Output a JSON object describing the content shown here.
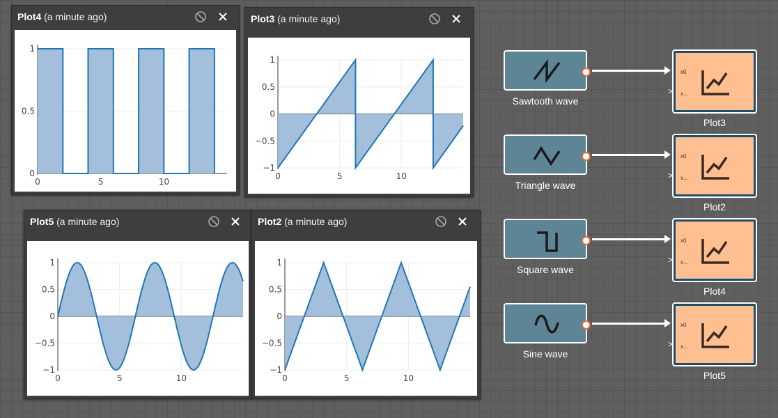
{
  "windows": [
    {
      "id": "plot4",
      "name": "Plot4",
      "ago": "(a minute ago)",
      "xticks": [
        0,
        5,
        10
      ],
      "yticks": [
        "1",
        "0.5",
        "0"
      ],
      "wave": "square",
      "ylim": [
        0,
        1
      ]
    },
    {
      "id": "plot3",
      "name": "Plot3",
      "ago": "(a minute ago)",
      "xticks": [
        0,
        5,
        10
      ],
      "yticks": [
        "1",
        "0.5",
        "0",
        "−0.5",
        "−1"
      ],
      "wave": "sawtooth",
      "ylim": [
        -1,
        1
      ]
    },
    {
      "id": "plot5",
      "name": "Plot5",
      "ago": "(a minute ago)",
      "xticks": [
        0,
        5,
        10
      ],
      "yticks": [
        "1",
        "0.5",
        "0",
        "−0.5",
        "−1"
      ],
      "wave": "sine",
      "ylim": [
        -1,
        1
      ]
    },
    {
      "id": "plot2",
      "name": "Plot2",
      "ago": "(a minute ago)",
      "xticks": [
        0,
        5,
        10
      ],
      "yticks": [
        "1",
        "0.5",
        "0",
        "−0.5",
        "−1"
      ],
      "wave": "triangle",
      "ylim": [
        -1,
        1
      ]
    }
  ],
  "chart_data": [
    {
      "type": "area",
      "series": [
        {
          "values": [
            [
              0,
              1
            ],
            [
              2,
              1
            ],
            [
              2,
              0
            ],
            [
              4,
              0
            ],
            [
              4,
              1
            ],
            [
              6,
              1
            ],
            [
              6,
              0
            ],
            [
              8,
              0
            ],
            [
              8,
              1
            ],
            [
              10,
              1
            ],
            [
              10,
              0
            ],
            [
              12,
              0
            ],
            [
              12,
              1
            ],
            [
              14,
              1
            ],
            [
              14,
              0
            ]
          ]
        }
      ],
      "xlim": [
        0,
        15
      ],
      "ylim": [
        0,
        1
      ]
    },
    {
      "type": "area",
      "series": [
        {
          "values": [
            [
              0,
              -1
            ],
            [
              6.28,
              1
            ],
            [
              6.28,
              -1
            ],
            [
              12.57,
              1
            ],
            [
              12.57,
              -1
            ],
            [
              15,
              -0.22
            ]
          ]
        }
      ],
      "xlim": [
        0,
        15
      ],
      "ylim": [
        -1,
        1
      ]
    },
    {
      "type": "area",
      "series": [
        {
          "function": "sin(x)",
          "x_range": [
            0,
            15
          ]
        }
      ],
      "xlim": [
        0,
        15
      ],
      "ylim": [
        -1,
        1
      ]
    },
    {
      "type": "area",
      "series": [
        {
          "values": [
            [
              0,
              -1
            ],
            [
              3.14,
              1
            ],
            [
              6.28,
              -1
            ],
            [
              9.42,
              1
            ],
            [
              12.57,
              -1
            ],
            [
              15,
              0.55
            ]
          ]
        }
      ],
      "xlim": [
        0,
        15
      ],
      "ylim": [
        -1,
        1
      ]
    }
  ],
  "graph": {
    "sources": [
      {
        "label": "Sawtooth wave",
        "icon": "sawtooth-icon"
      },
      {
        "label": "Triangle wave",
        "icon": "triangle-wave-icon"
      },
      {
        "label": "Square wave",
        "icon": "square-wave-icon"
      },
      {
        "label": "Sine wave",
        "icon": "sine-wave-icon"
      }
    ],
    "sinks": [
      {
        "label": "Plot3",
        "pin0": "x0",
        "pin1": "x..."
      },
      {
        "label": "Plot2",
        "pin0": "x0",
        "pin1": "x..."
      },
      {
        "label": "Plot4",
        "pin0": "x0",
        "pin1": "x..."
      },
      {
        "label": "Plot5",
        "pin0": "x0",
        "pin1": "x..."
      }
    ]
  },
  "colors": {
    "accent": "#1f77b4",
    "fill": "#9fbcda",
    "node": "#5e8596",
    "plot_node": "#ffbf90",
    "port": "#e8703f"
  }
}
